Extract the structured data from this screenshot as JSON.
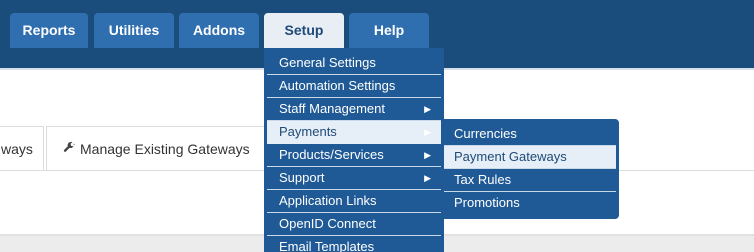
{
  "nav": {
    "tabs": [
      {
        "label": "Reports"
      },
      {
        "label": "Utilities"
      },
      {
        "label": "Addons"
      },
      {
        "label": "Setup"
      },
      {
        "label": "Help"
      }
    ]
  },
  "content_tabs": {
    "partial_label": "ways",
    "active_label": "Manage Existing Gateways"
  },
  "setup_menu": {
    "items": [
      {
        "label": "General Settings"
      },
      {
        "label": "Automation Settings"
      },
      {
        "label": "Staff Management"
      },
      {
        "label": "Payments"
      },
      {
        "label": "Products/Services"
      },
      {
        "label": "Support"
      },
      {
        "label": "Application Links"
      },
      {
        "label": "OpenID Connect"
      },
      {
        "label": "Email Templates"
      }
    ]
  },
  "payments_submenu": {
    "items": [
      {
        "label": "Currencies"
      },
      {
        "label": "Payment Gateways"
      },
      {
        "label": "Tax Rules"
      },
      {
        "label": "Promotions"
      }
    ]
  },
  "icons": {
    "wrench": "wrench-icon",
    "submenu_arrow": "caret-right-icon"
  },
  "colors": {
    "nav_bg": "#1a4d7c",
    "tab_bg": "#2f6eaf",
    "menu_bg": "#1f5a96",
    "highlight_bg": "#e6eef7"
  }
}
